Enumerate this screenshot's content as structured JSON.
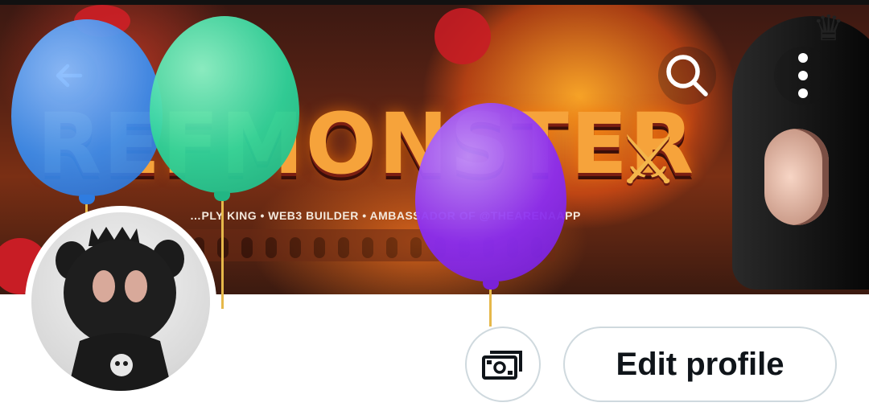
{
  "banner": {
    "title": "REFMONSTER",
    "swords_glyph": "⚔",
    "tagline": "…PLY KING • WEB3 BUILDER • AMBASSADOR OF @THEARENAAPP"
  },
  "nav": {
    "back_icon": "arrow-left-icon",
    "search_icon": "search-icon",
    "more_icon": "more-vertical-icon"
  },
  "balloons": [
    {
      "color": "#3b8ef0",
      "name": "blue"
    },
    {
      "color": "#2ed39a",
      "name": "green"
    },
    {
      "color": "#8b2df0",
      "name": "purple"
    }
  ],
  "profile": {
    "edit_label": "Edit profile",
    "money_icon": "money-icon"
  },
  "colors": {
    "button_border": "#cfd9de",
    "text": "#0f1419"
  }
}
